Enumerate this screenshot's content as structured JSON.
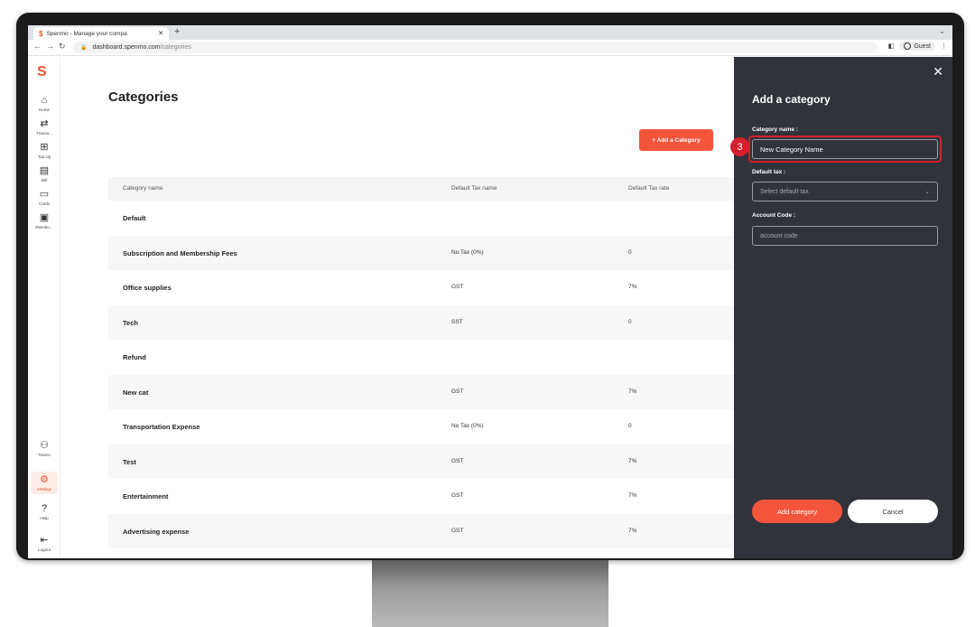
{
  "browser": {
    "tab_title": "Spenmo - Manage your compa",
    "url_host": "dashboard.spenmo.com",
    "url_path": "/categories",
    "profile_label": "Guest"
  },
  "sidebar": {
    "logo": "S",
    "items": [
      {
        "label": "Home",
        "icon": "home-icon",
        "glyph": "⌂"
      },
      {
        "label": "Transa...",
        "icon": "transactions-icon",
        "glyph": "⇄"
      },
      {
        "label": "Top Up",
        "icon": "topup-icon",
        "glyph": "⊞"
      },
      {
        "label": "Bill",
        "icon": "bill-icon",
        "glyph": "▤"
      },
      {
        "label": "Cards",
        "icon": "cards-icon",
        "glyph": "▭"
      },
      {
        "label": "Reimbu...",
        "icon": "reimburse-icon",
        "glyph": "▣"
      }
    ],
    "bottom_items": [
      {
        "label": "Teams",
        "icon": "teams-icon",
        "glyph": "⚇"
      },
      {
        "label": "Settings",
        "icon": "settings-icon",
        "glyph": "⚙",
        "active": true
      },
      {
        "label": "Help",
        "icon": "help-icon",
        "glyph": "?"
      },
      {
        "label": "Logout",
        "icon": "logout-icon",
        "glyph": "⇤"
      }
    ]
  },
  "main": {
    "title": "Categories",
    "add_button": "+ Add a Category",
    "columns": [
      "Category name",
      "Default Tax name",
      "Default Tax rate"
    ],
    "rows": [
      {
        "name": "Default",
        "tax": "",
        "rate": ""
      },
      {
        "name": "Subscription and Membership Fees",
        "tax": "No Tax (0%)",
        "rate": "0"
      },
      {
        "name": "Office supplies",
        "tax": "GST",
        "rate": "7%"
      },
      {
        "name": "Tech",
        "tax": "SST",
        "rate": "0"
      },
      {
        "name": "Refund",
        "tax": "",
        "rate": ""
      },
      {
        "name": "New cat",
        "tax": "GST",
        "rate": "7%"
      },
      {
        "name": "Transportation Expense",
        "tax": "No Tax (0%)",
        "rate": "0"
      },
      {
        "name": "Test",
        "tax": "GST",
        "rate": "7%"
      },
      {
        "name": "Entertainment",
        "tax": "GST",
        "rate": "7%"
      },
      {
        "name": "Advertising expense",
        "tax": "GST",
        "rate": "7%"
      }
    ]
  },
  "drawer": {
    "title": "Add a category",
    "category_name_label": "Category name :",
    "category_name_value": "New Category Name",
    "default_tax_label": "Default tax :",
    "default_tax_placeholder": "Select default tax",
    "account_code_label": "Account Code :",
    "account_code_placeholder": "account code",
    "add_button": "Add category",
    "cancel_button": "Cancel",
    "step_number": "3"
  },
  "colors": {
    "accent": "#f2553c",
    "drawer_bg": "#30333a",
    "highlight": "#d41f2d"
  }
}
